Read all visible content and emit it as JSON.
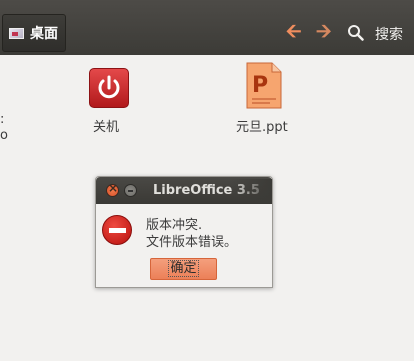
{
  "toolbar": {
    "location_label": "桌面",
    "back_icon": "back-arrow-icon",
    "forward_icon": "forward-arrow-icon",
    "search_label": "搜索",
    "accent_color": "#ef8d5e"
  },
  "files": [
    {
      "label": "关机",
      "icon": "power-icon"
    },
    {
      "label": "元旦.ppt",
      "icon": "presentation-file-icon"
    }
  ],
  "clipped_text": [
    ":",
    "o"
  ],
  "dialog": {
    "title": "LibreOffice 3.5",
    "message_line_1": "版本冲突.",
    "message_line_2": "文件版本错误。",
    "ok_label": "确定",
    "icon": "error-icon"
  }
}
